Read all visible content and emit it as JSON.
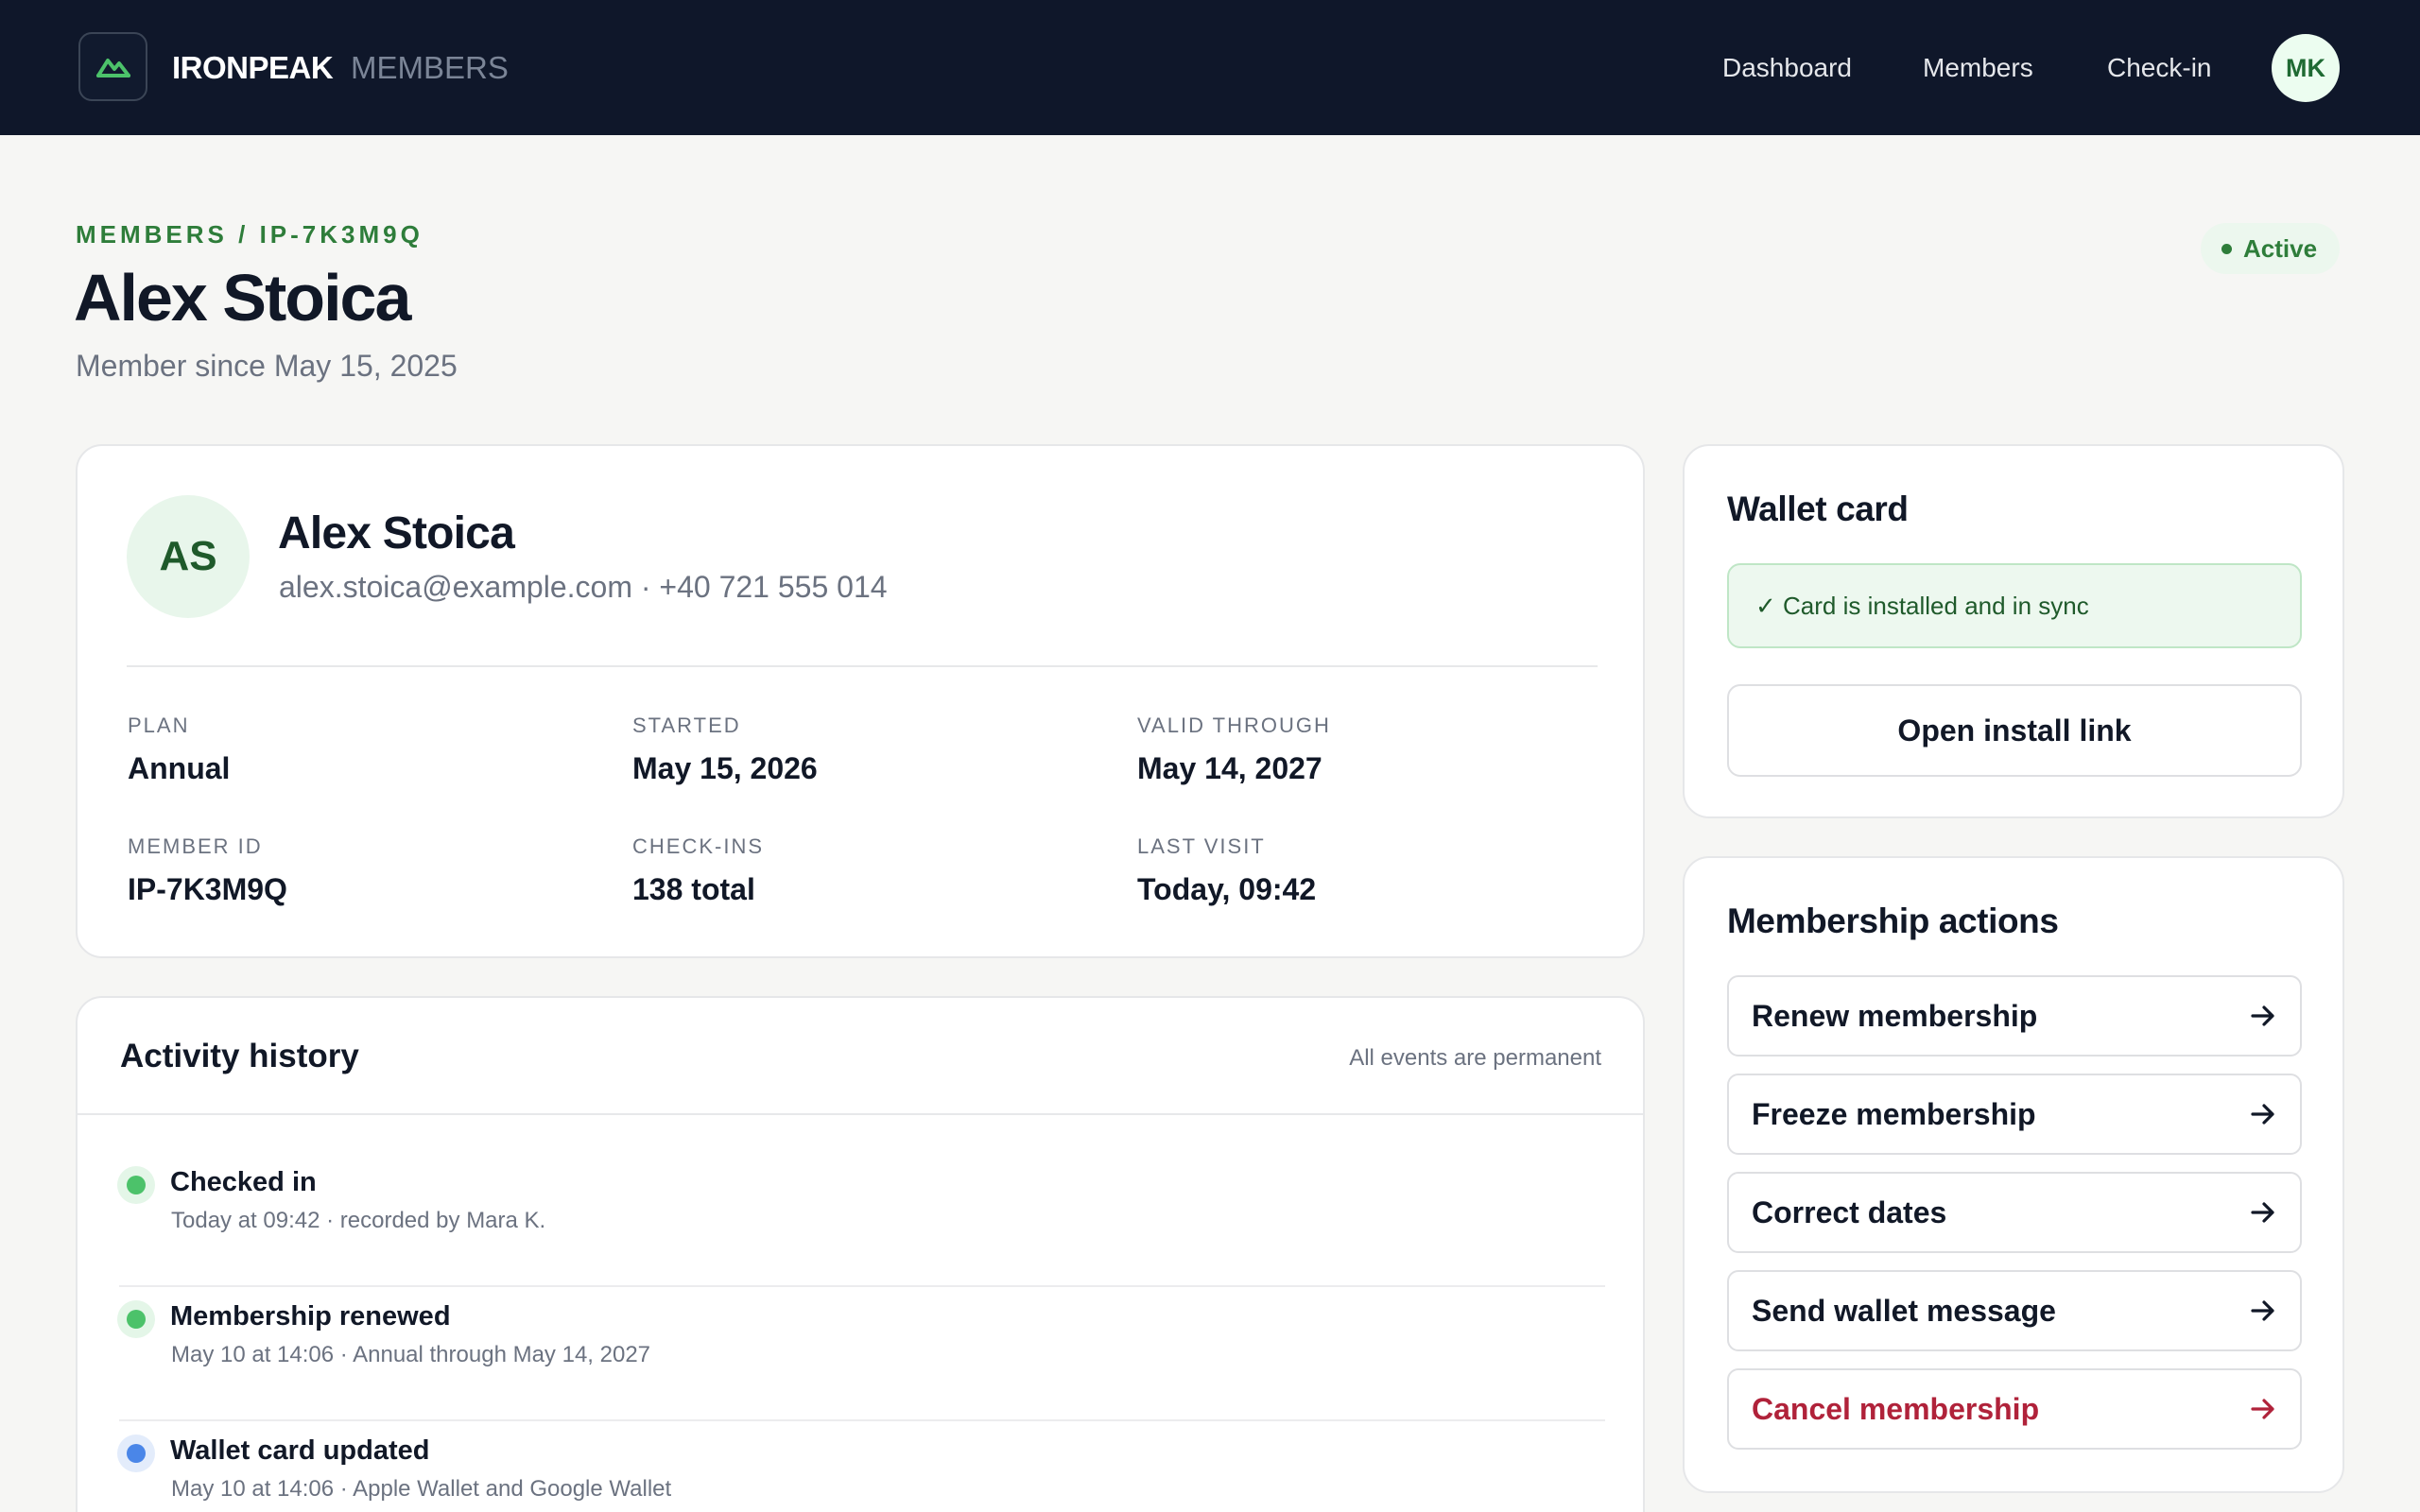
{
  "header": {
    "brand": "IRONPEAK",
    "brand_sub": "MEMBERS",
    "nav": [
      "Dashboard",
      "Members",
      "Check-in"
    ],
    "user_initials": "MK"
  },
  "page": {
    "breadcrumb": "MEMBERS / IP-7K3M9Q",
    "title": "Alex Stoica",
    "member_since": "Member since May 15, 2025",
    "status": "Active"
  },
  "profile": {
    "initials": "AS",
    "name": "Alex Stoica",
    "contact": "alex.stoica@example.com · +40 721 555 014",
    "stats": [
      {
        "label": "PLAN",
        "value": "Annual"
      },
      {
        "label": "STARTED",
        "value": "May 15, 2026"
      },
      {
        "label": "VALID THROUGH",
        "value": "May 14, 2027"
      },
      {
        "label": "MEMBER ID",
        "value": "IP-7K3M9Q"
      },
      {
        "label": "CHECK-INS",
        "value": "138 total"
      },
      {
        "label": "LAST VISIT",
        "value": "Today, 09:42"
      }
    ]
  },
  "activity": {
    "title": "Activity history",
    "note": "All events are permanent",
    "events": [
      {
        "title": "Checked in",
        "detail": "Today at 09:42 · recorded by Mara K.",
        "color": "#4cc26a"
      },
      {
        "title": "Membership renewed",
        "detail": "May 10 at 14:06 · Annual through May 14, 2027",
        "color": "#4cc26a"
      },
      {
        "title": "Wallet card updated",
        "detail": "May 10 at 14:06 · Apple Wallet and Google Wallet",
        "color": "#4a86e8"
      }
    ]
  },
  "wallet": {
    "title": "Wallet card",
    "sync_status": "✓ Card is installed and in sync",
    "install_label": "Open install link"
  },
  "actions": {
    "title": "Membership actions",
    "items": [
      {
        "label": "Renew membership"
      },
      {
        "label": "Freeze membership"
      },
      {
        "label": "Correct dates"
      },
      {
        "label": "Send wallet message"
      },
      {
        "label": "Cancel membership"
      }
    ],
    "danger_color": "#b0223a"
  },
  "icons": {
    "logo": "mountain-icon",
    "arrow": "arrow-right-icon"
  }
}
